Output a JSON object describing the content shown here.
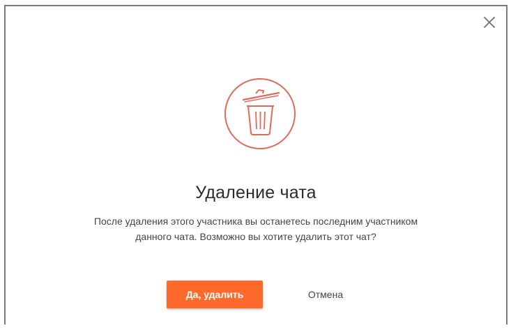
{
  "dialog": {
    "title": "Удаление чата",
    "message_line1": "После удаления этого участника вы останетесь последним участником",
    "message_line2": "данного чата. Возможно вы хотите удалить этот чат?",
    "confirm_label": "Да, удалить",
    "cancel_label": "Отмена",
    "close_icon": "close-icon",
    "main_icon": "trash-icon"
  },
  "colors": {
    "accent": "#ff6a2c",
    "icon_stroke": "#e06a5c",
    "text": "#2b2b2b"
  }
}
